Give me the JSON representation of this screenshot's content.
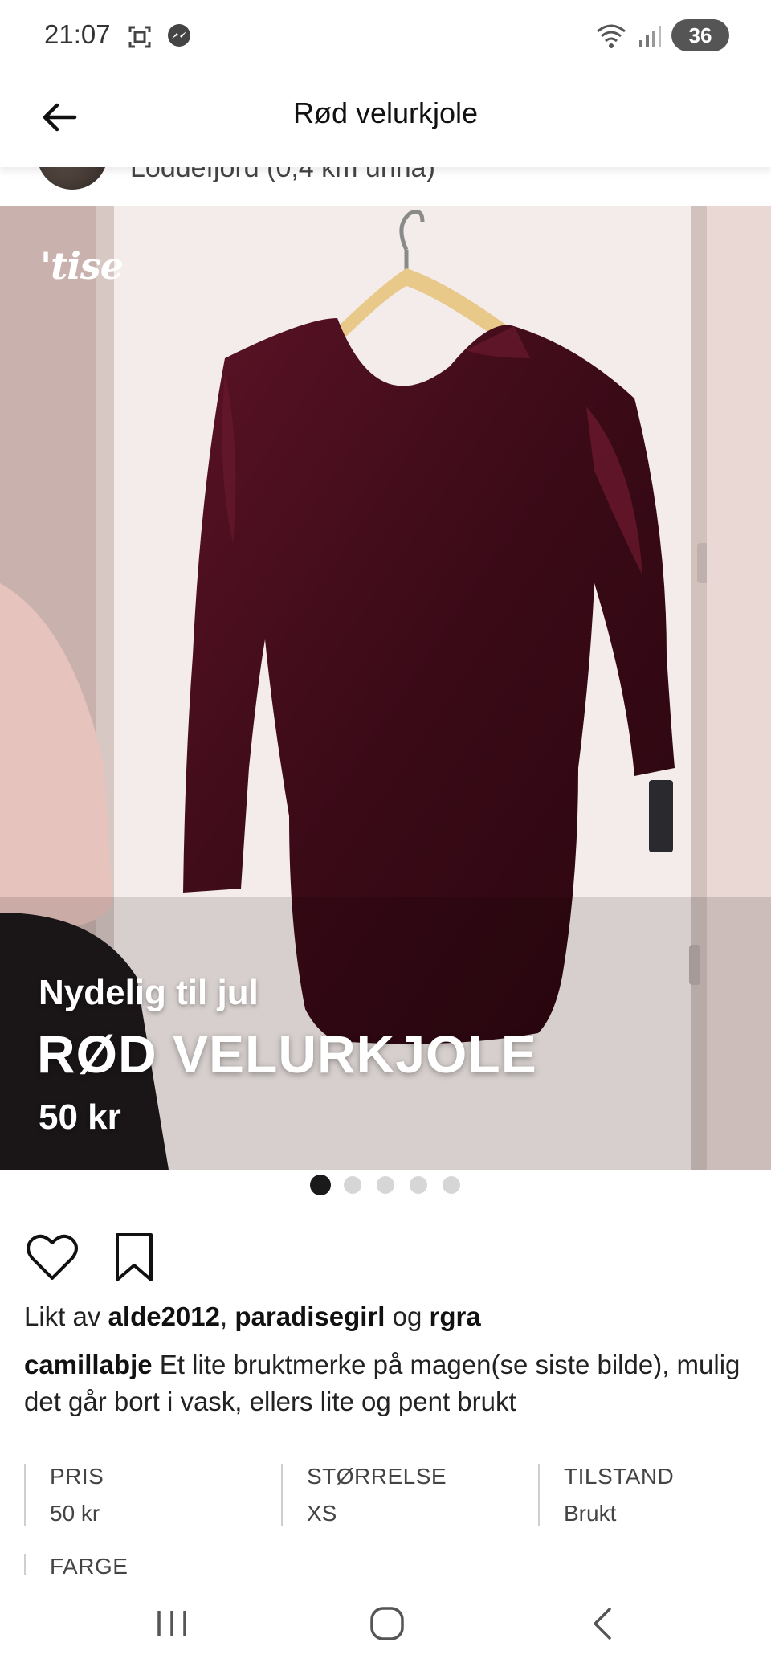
{
  "status_bar": {
    "time": "21:07",
    "battery": "36",
    "icons": [
      "screenshot-icon",
      "messenger-icon",
      "wifi-icon",
      "signal-icon"
    ]
  },
  "header": {
    "title": "Rød velurkjole",
    "back_icon": "arrow-left-icon"
  },
  "seller": {
    "location": "Loddefjord (0,4 km unna)"
  },
  "image": {
    "logo": "'tise",
    "subtitle": "Nydelig til jul",
    "title": "RØD VELURKJOLE",
    "price": "50 kr",
    "page_count": 5,
    "active_page": 1
  },
  "actions": {
    "like_icon": "heart-icon",
    "save_icon": "bookmark-icon"
  },
  "likes": {
    "prefix": "Likt av",
    "users": [
      "alde2012",
      "paradisegirl",
      "rgra"
    ],
    "separator": ",",
    "conjunction": "og"
  },
  "description": {
    "author": "camillabje",
    "text": "Et lite bruktmerke på magen(se siste bilde), mulig det går bort i vask, ellers lite og pent brukt"
  },
  "attributes": [
    {
      "label": "PRIS",
      "value": "50 kr"
    },
    {
      "label": "STØRRELSE",
      "value": "XS"
    },
    {
      "label": "TILSTAND",
      "value": "Brukt"
    },
    {
      "label": "FARGE",
      "value": ""
    }
  ],
  "nav": {
    "icons": [
      "recent-apps-icon",
      "home-icon",
      "back-icon"
    ]
  },
  "colors": {
    "dress": "#4a0f1e",
    "wall": "#eadcd8",
    "hanger": "#e9c98a"
  }
}
